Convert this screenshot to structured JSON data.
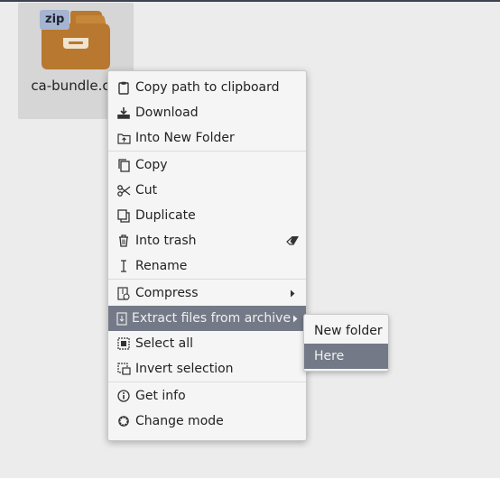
{
  "file": {
    "name": "ca-bundle.crt",
    "badge": "zip"
  },
  "colors": {
    "folder_brown": "#b8782f",
    "menu_highlight": "#737987",
    "badge_bg": "#a5b4d0"
  },
  "context_menu": {
    "items": [
      {
        "label": "Copy path to clipboard",
        "icon": "clipboard-icon"
      },
      {
        "label": "Download",
        "icon": "download-icon"
      },
      {
        "label": "Into New Folder",
        "icon": "folder-into-icon"
      },
      {
        "label": "Copy",
        "icon": "copy-icon"
      },
      {
        "label": "Cut",
        "icon": "scissors-icon"
      },
      {
        "label": "Duplicate",
        "icon": "duplicate-icon"
      },
      {
        "label": "Into trash",
        "icon": "trash-icon",
        "shortcut_icon": "eraser-icon"
      },
      {
        "label": "Rename",
        "icon": "text-cursor-icon"
      },
      {
        "label": "Compress",
        "icon": "compress-icon",
        "has_submenu": true
      },
      {
        "label": "Extract files from archive",
        "icon": "extract-icon",
        "has_submenu": true,
        "active": true
      },
      {
        "label": "Select all",
        "icon": "select-all-icon"
      },
      {
        "label": "Invert selection",
        "icon": "invert-selection-icon"
      },
      {
        "label": "Get info",
        "icon": "info-icon"
      },
      {
        "label": "Change mode",
        "icon": "gear-icon"
      }
    ]
  },
  "submenu": {
    "items": [
      {
        "label": "New folder"
      },
      {
        "label": "Here",
        "active": true
      }
    ]
  }
}
